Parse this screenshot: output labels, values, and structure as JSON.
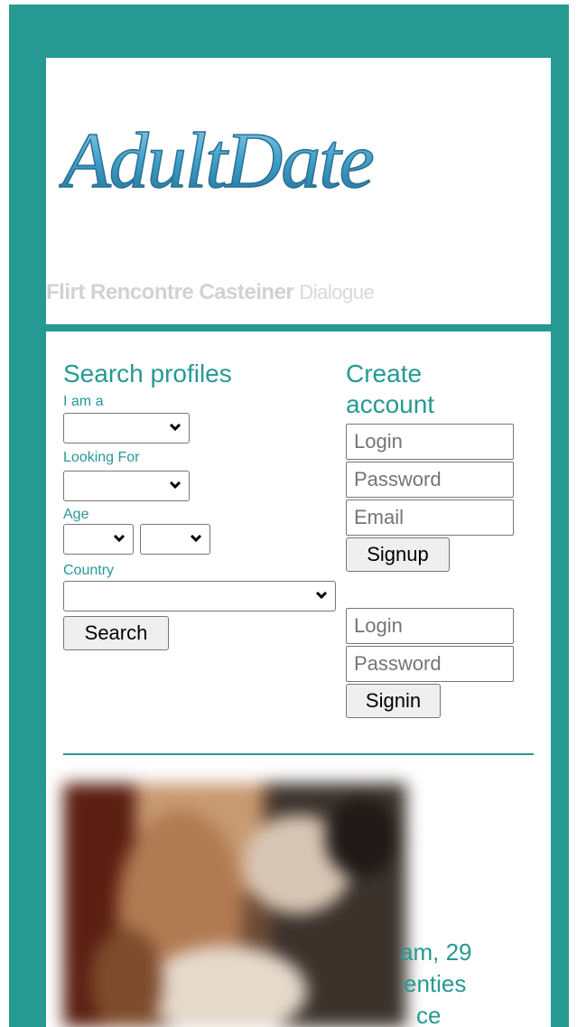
{
  "header": {
    "logo_text": "AdultDate",
    "tagline_bold": "Flirt Rencontre Casteiner",
    "tagline_light": "Dialogue"
  },
  "search": {
    "title": "Search profiles",
    "i_am_label": "I am a",
    "looking_for_label": "Looking For",
    "age_label": "Age",
    "country_label": "Country",
    "button": "Search"
  },
  "account": {
    "title": "Create account",
    "login_placeholder": "Login",
    "password_placeholder": "Password",
    "email_placeholder": "Email",
    "signup_button": "Signup",
    "signin_login_placeholder": "Login",
    "signin_password_placeholder": "Password",
    "signin_button": "Signin"
  },
  "profile": {
    "line1": "am, 29",
    "line2": "enties",
    "line3": "ce"
  },
  "colors": {
    "accent": "#269993",
    "logo": "#3a9bc4"
  }
}
